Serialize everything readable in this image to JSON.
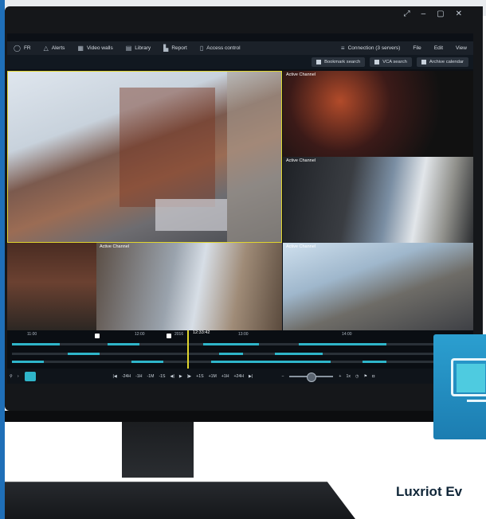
{
  "window_controls": [
    "⤢",
    "–",
    "▢",
    "✕"
  ],
  "menu": {
    "items": [
      {
        "icon": "user-icon",
        "label": "FR"
      },
      {
        "icon": "bell-icon",
        "label": "Alerts"
      },
      {
        "icon": "grid-icon",
        "label": "Video walls"
      },
      {
        "icon": "library-icon",
        "label": "Library"
      },
      {
        "icon": "chart-icon",
        "label": "Report"
      },
      {
        "icon": "door-icon",
        "label": "Access control"
      }
    ],
    "right": {
      "connection": "Connection (3 servers)",
      "file": "File",
      "edit": "Edit",
      "view": "View"
    }
  },
  "toolbar": {
    "bookmark_search": "Bookmark search",
    "vca_search": "VCA search",
    "archive_calendar": "Archive calendar"
  },
  "cameras": {
    "r1_label": "Active Channel",
    "r2_label": "Active Channel",
    "b2_label": "Active Channel",
    "b3_label": "Active Channel"
  },
  "timeline": {
    "ticks": [
      "11:00",
      "12:00",
      "2016",
      "13:00",
      "14:00"
    ],
    "cursor_time": "12:33:42"
  },
  "playback": {
    "buttons": [
      "|◀",
      "-24H",
      "-1H",
      "-1M",
      "-1S",
      "◀|",
      "▶",
      "|▶",
      "+1S",
      "+1M",
      "+1H",
      "+24H",
      "▶|"
    ],
    "speed": "1x",
    "minus": "−",
    "plus": "+"
  },
  "brand_text": "Luxriot Ev",
  "colors": {
    "accent": "#2fb5c9",
    "active_border": "#e0d52e",
    "brand_blue": "#1f6fb8"
  }
}
